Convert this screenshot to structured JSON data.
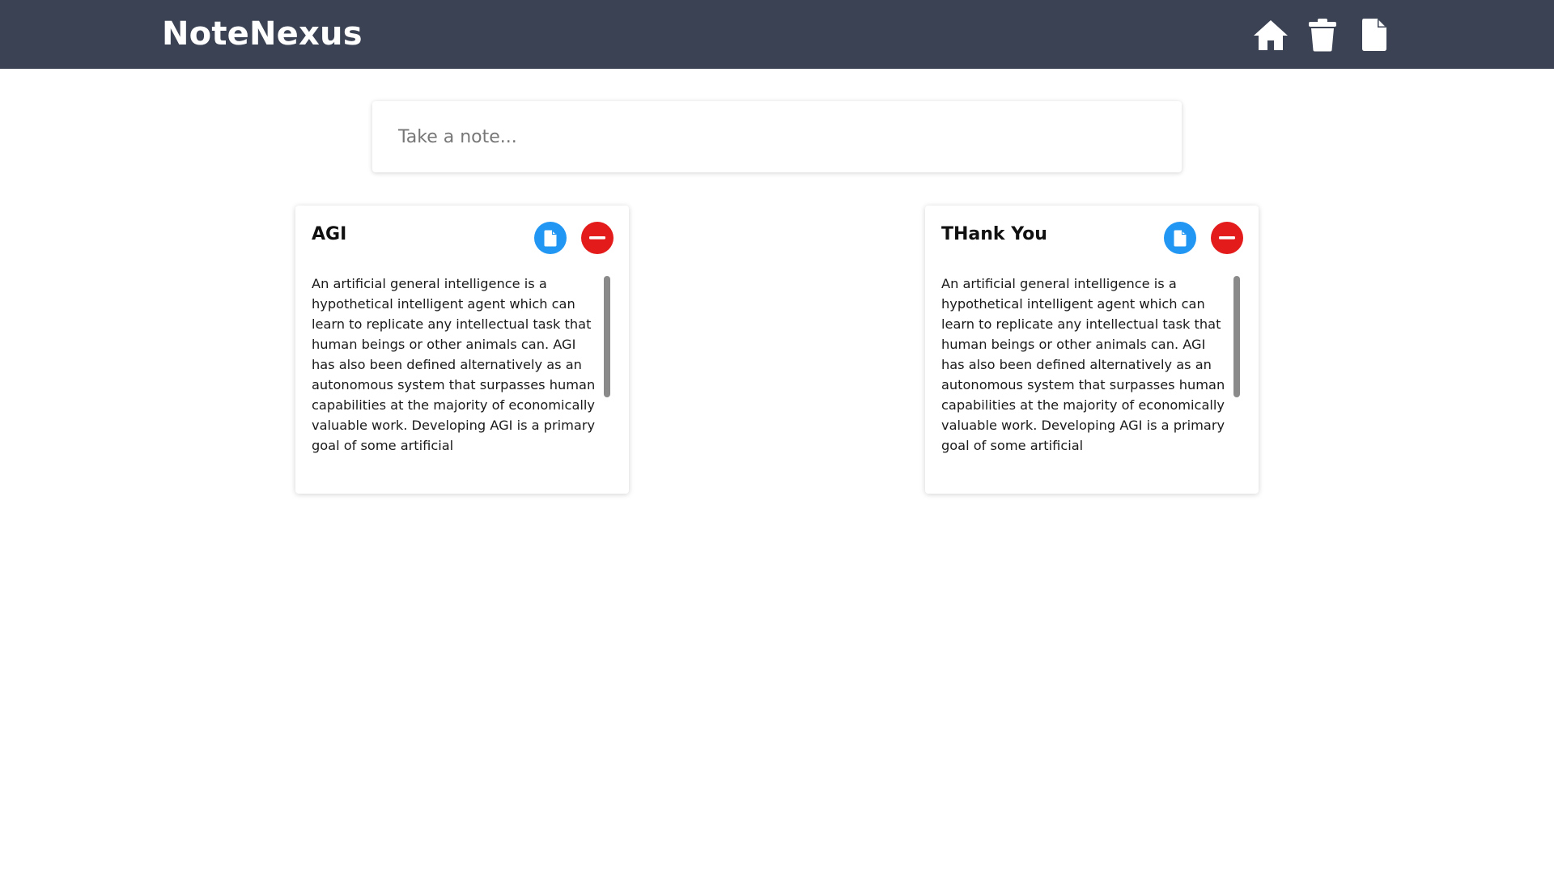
{
  "header": {
    "brand": "NoteNexus",
    "nav": [
      {
        "name": "home",
        "icon": "home-icon"
      },
      {
        "name": "trash",
        "icon": "trash-icon"
      },
      {
        "name": "notes",
        "icon": "file-icon"
      }
    ]
  },
  "composer": {
    "placeholder": "Take a note..."
  },
  "notes": [
    {
      "title": "AGI",
      "body": "An artificial general intelligence is a hypothetical intelligent agent which can learn to replicate any intellectual task that human beings or other animals can. AGI has also been defined alternatively as an autonomous system that surpasses human capabilities at the majority of economically valuable work. Developing AGI is a primary goal of some artificial",
      "edit_icon": "file-icon",
      "delete_icon": "minus-icon"
    },
    {
      "title": "THank You",
      "body": "An artificial general intelligence is a hypothetical intelligent agent which can learn to replicate any intellectual task that human beings or other animals can. AGI has also been defined alternatively as an autonomous system that surpasses human capabilities at the majority of economically valuable work. Developing AGI is a primary goal of some artificial",
      "edit_icon": "file-icon",
      "delete_icon": "minus-icon"
    }
  ],
  "colors": {
    "header_bg": "#3a4253",
    "edit_button": "#2196f3",
    "delete_button": "#e31b1b"
  }
}
